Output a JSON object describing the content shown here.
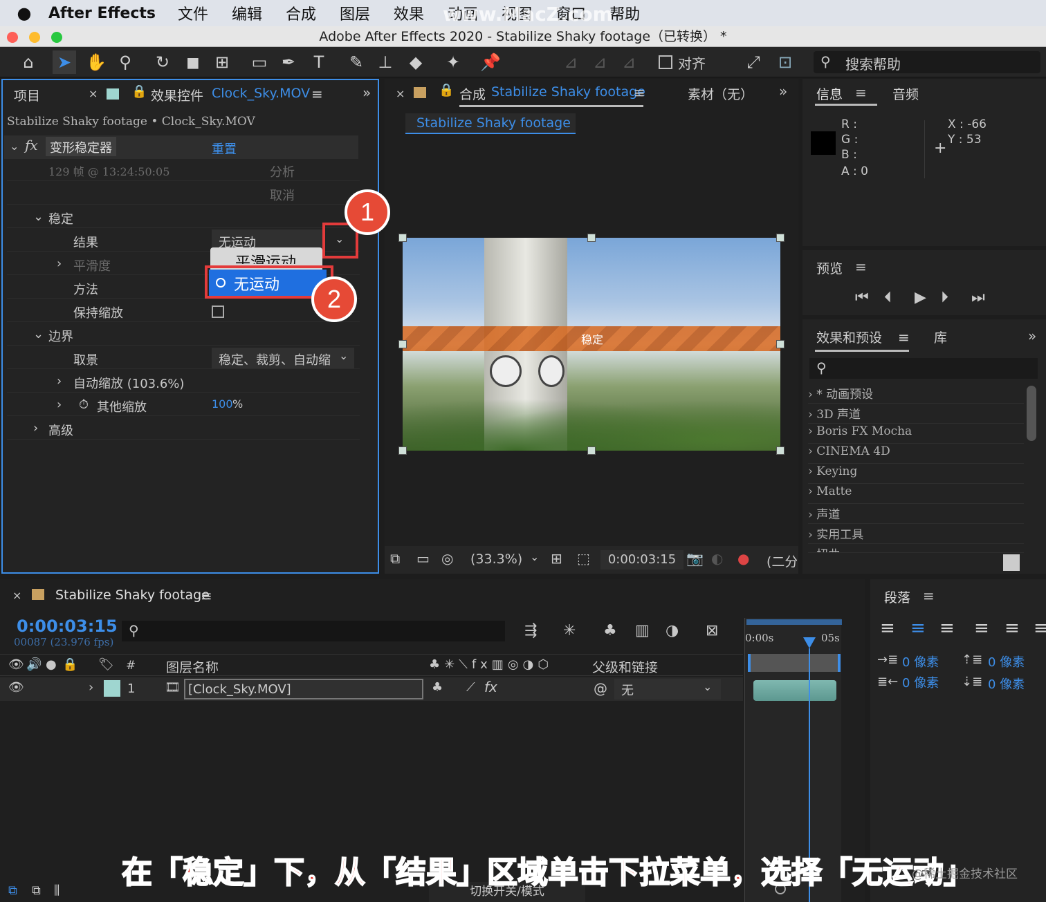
{
  "menubar": {
    "app": "After Effects",
    "items": [
      "文件",
      "编辑",
      "合成",
      "图层",
      "效果",
      "动画",
      "视图",
      "窗口",
      "帮助"
    ],
    "watermark": "www.MacZ.com"
  },
  "window": {
    "title": "Adobe After Effects 2020 - Stabilize Shaky footage（已转换） *"
  },
  "toolbar": {
    "align_label": "对齐",
    "search_help": "搜索帮助"
  },
  "project_panel": {
    "tab_project": "项目",
    "tab_effects": "效果控件",
    "effects_file": "Clock_Sky.MOV",
    "breadcrumb": "Stabilize Shaky footage • Clock_Sky.MOV",
    "fx_name": "变形稳定器",
    "reset": "重置",
    "frames_info": "129 帧 @ 13:24:50:05",
    "analyze": "分析",
    "cancel": "取消",
    "section_stabilize": "稳定",
    "result_label": "结果",
    "result_value": "无运动",
    "smoothness_label": "平滑度",
    "method_label": "方法",
    "keep_scale_label": "保持缩放",
    "section_border": "边界",
    "framing_label": "取景",
    "framing_value": "稳定、裁剪、自动缩",
    "auto_scale": "自动缩放 (103.6%)",
    "other_scale_label": "其他缩放",
    "other_scale_value": "100",
    "other_scale_unit": "%",
    "advanced": "高级",
    "dropdown_options": [
      "平滑运动",
      "无运动"
    ],
    "dropdown_selected": "无运动"
  },
  "comp_panel": {
    "tab_label": "合成",
    "comp_name": "Stabilize Shaky footage",
    "footage_tab": "素材（无）",
    "subtab": "Stabilize Shaky footage",
    "overlay_text": "稳定",
    "zoom": "(33.3%)",
    "timecode": "0:00:03:15",
    "resolution": "(二分"
  },
  "info_panel": {
    "tab_info": "信息",
    "tab_audio": "音频",
    "r": "R :",
    "g": "G :",
    "b": "B :",
    "a": "A :  0",
    "x": "X : -66",
    "y": "Y :  53"
  },
  "preview_panel": {
    "title": "预览"
  },
  "effects_presets": {
    "title": "效果和预设",
    "library": "库",
    "items": [
      "* 动画预设",
      "3D 声道",
      "Boris FX Mocha",
      "CINEMA 4D",
      "Keying",
      "Matte",
      "声道",
      "实用工具",
      "扭曲"
    ]
  },
  "timeline": {
    "comp_name": "Stabilize Shaky footage",
    "timecode": "0:00:03:15",
    "frames": "00087 (23.976 fps)",
    "col_num": "#",
    "col_layer_name": "图层名称",
    "col_parent": "父级和链接",
    "layer_num": "1",
    "layer_name": "[Clock_Sky.MOV]",
    "parent_value": "无",
    "ruler_start": "0:00s",
    "ruler_05": "05s",
    "footer_toggle": "切换开关/模式"
  },
  "paragraph_panel": {
    "title": "段落",
    "indent_left": "0 像素",
    "indent_right": "0 像素",
    "space_before": "0 像素",
    "space_after": "0 像素"
  },
  "annotations": {
    "badge1": "1",
    "badge2": "2",
    "caption": "在「稳定」下，从「结果」区域单击下拉菜单，选择「无运动」",
    "credit": "@稀土掘金技术社区"
  },
  "colors": {
    "accent": "#3d8ee8",
    "annotation_red": "#e33b3b",
    "overlay_orange": "#d9691f"
  }
}
